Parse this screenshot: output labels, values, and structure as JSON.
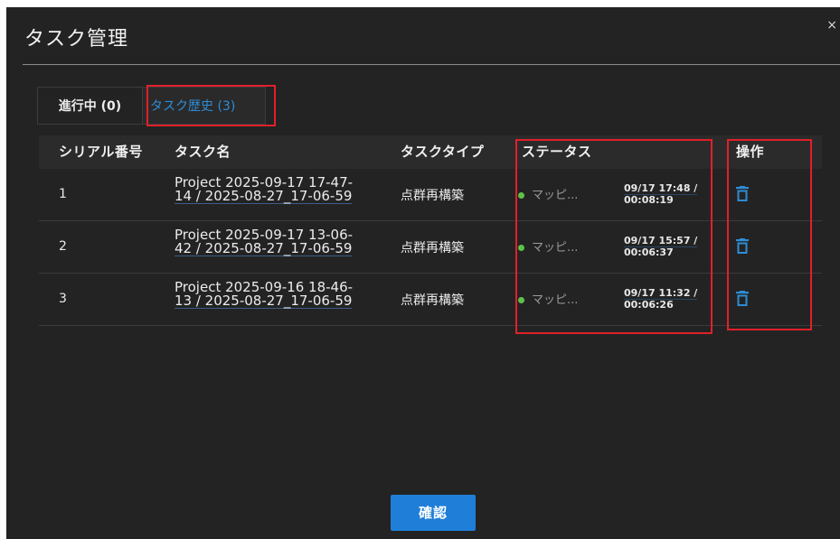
{
  "dialog": {
    "title": "タスク管理",
    "close_glyph": "×"
  },
  "tabs": [
    {
      "label": "進行中 (0)",
      "active": false
    },
    {
      "label": "タスク歴史 (3)",
      "active": true
    }
  ],
  "table": {
    "headers": {
      "serial": "シリアル番号",
      "name": "タスク名",
      "type": "タスクタイプ",
      "status": "ステータス",
      "actions": "操作"
    },
    "rows": [
      {
        "serial": "1",
        "name_line1": "Project 2025-09-17 17-47-",
        "name_line2": "14 / 2025-08-27_17-06-59",
        "type": "点群再構築",
        "status": "マッピ...",
        "time_line1": "09/17 17:48 /",
        "time_line2": "00:08:19",
        "action_icon": "trash-icon"
      },
      {
        "serial": "2",
        "name_line1": "Project 2025-09-17 13-06-",
        "name_line2": "42 / 2025-08-27_17-06-59",
        "type": "点群再構築",
        "status": "マッピ...",
        "time_line1": "09/17 15:57 /",
        "time_line2": "00:06:37",
        "action_icon": "trash-icon"
      },
      {
        "serial": "3",
        "name_line1": "Project 2025-09-16 18-46-",
        "name_line2": "13 / 2025-08-27_17-06-59",
        "type": "点群再構築",
        "status": "マッピ...",
        "time_line1": "09/17 11:32 /",
        "time_line2": "00:06:26",
        "action_icon": "trash-icon"
      }
    ]
  },
  "footer": {
    "confirm_label": "確認"
  },
  "colors": {
    "background": "#232323",
    "accent": "#1f7fd8",
    "status_dot": "#5cc34a",
    "highlight": "#e0202a"
  }
}
